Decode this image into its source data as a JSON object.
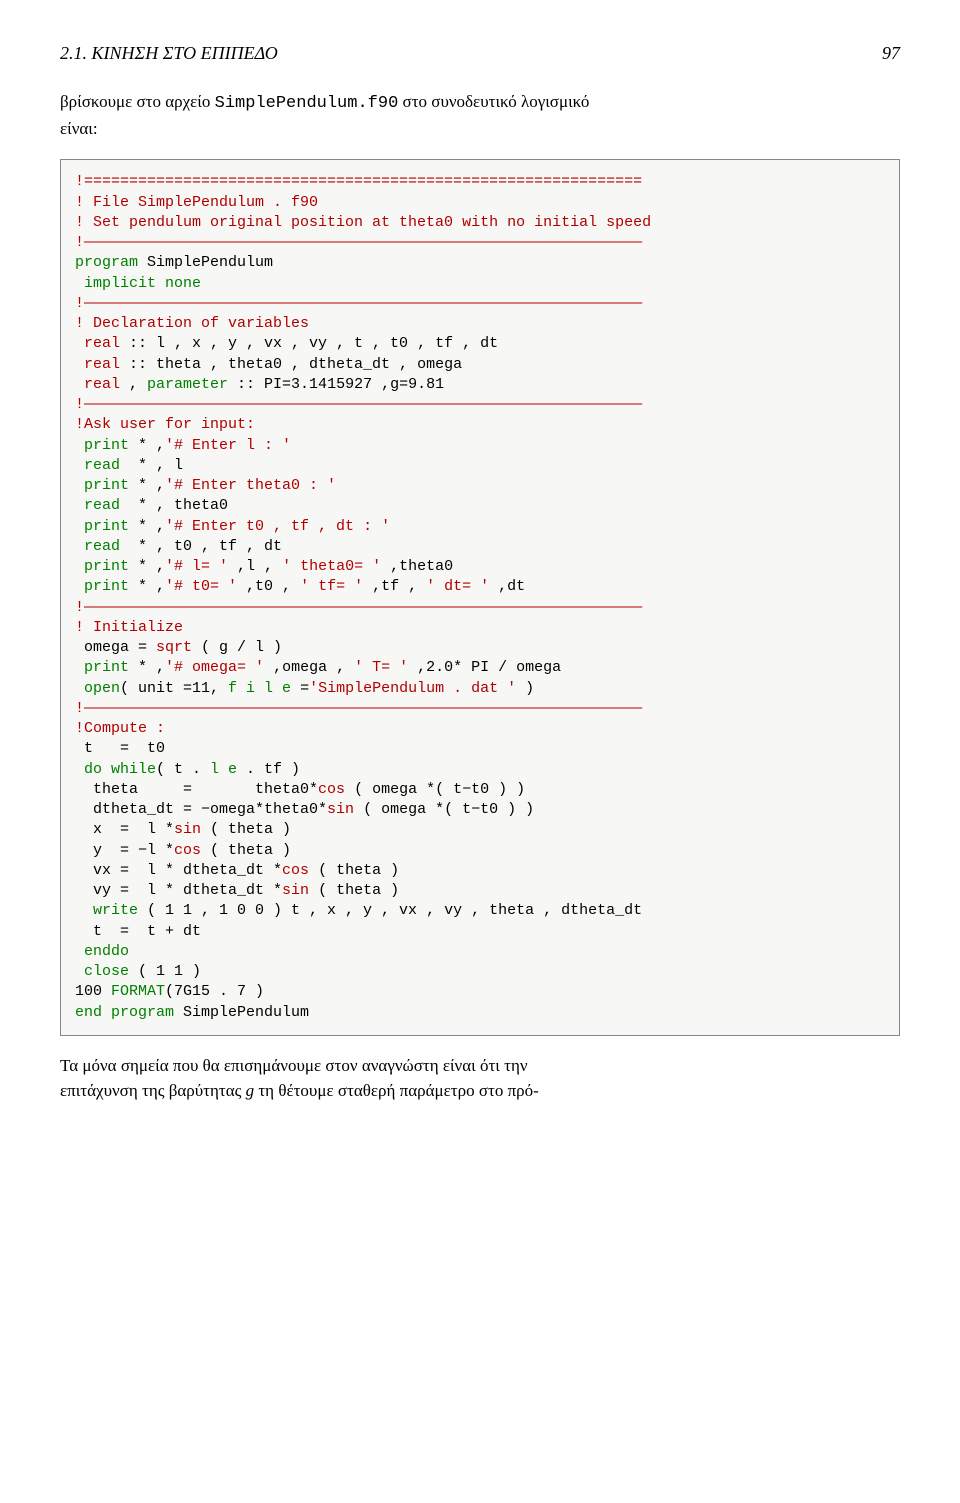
{
  "header": {
    "section": "2.1. ΚΙΝΗΣΗ ΣΤΟ ΕΠΙΠΕΔΟ",
    "page": "97"
  },
  "intro": {
    "line1_a": "βρίσκουμε στο αρχείο ",
    "line1_code": "SimplePendulum.f90",
    "line1_b": " στο συνοδευτικό λογισμικό",
    "line2": "είναι:"
  },
  "code": {
    "c1": "!==============================================================",
    "c2": "! File SimplePendulum . f90",
    "c3": "! Set pendulum original position at theta0 with no initial speed",
    "c4": "!——————————————————————————————————————————————————————————————",
    "kw_program": "program",
    "prog_name": " SimplePendulum",
    "kw_implicit": " implicit none",
    "c5": "!——————————————————————————————————————————————————————————————",
    "c6": "! Declaration of variables",
    "ty_real1": " real",
    "decl1": " :: l , x , y , vx , vy , t , t0 , tf , dt",
    "ty_real2": " real",
    "decl2": " :: theta , theta0 , dtheta_dt , omega",
    "ty_real3": " real",
    "param_kw": "parameter",
    "decl3a": " , ",
    "decl3b": " :: PI=3.1415927 ,g=9.81",
    "c7": "!——————————————————————————————————————————————————————————————",
    "c8": "!Ask user for input:",
    "kw_print": " print",
    "kw_read": " read",
    "s_enter_l": "'# Enter l : '",
    "rd_l": "  * , l",
    "s_enter_th0": "'# Enter theta0 : '",
    "rd_th0": "  * , theta0",
    "s_enter_t": "'# Enter t0 , tf , dt : '",
    "rd_t": "  * , t0 , tf , dt",
    "s_l_eq": "'# l= '",
    "s_th0_eq": "' theta0= '",
    "mid_l": " * ,",
    "mid_l2": " ,l , ",
    "mid_th0": " ,theta0",
    "s_t0_eq": "'# t0= '",
    "s_tf_eq": "' tf= '",
    "s_dt_eq": "' dt= '",
    "mid_t0": " ,t0 , ",
    "mid_tf": " ,tf , ",
    "mid_dt": " ,dt",
    "c9": "!——————————————————————————————————————————————————————————————",
    "c10": "! Initialize",
    "omega_line_a": " omega = ",
    "fn_sqrt": "sqrt",
    "omega_line_b": " ( g / l )",
    "s_omega": "'# omega= '",
    "s_T": "' T= '",
    "pr_omega_mid": " ,omega , ",
    "pr_T_end": " ,2.0* PI / omega",
    "kw_open": " open",
    "open_a": "( unit =11, ",
    "file_kw": "f i l e",
    "open_b": " =",
    "s_file": "'SimplePendulum . dat '",
    "open_c": " )",
    "c11": "!——————————————————————————————————————————————————————————————",
    "c12": "!Compute :",
    "t_eq_t0": " t   =  t0",
    "kw_do": " do while",
    "dow_a": "( t . ",
    "le_kw": "l e",
    "dow_b": " . tf )",
    "th_line_a": "  theta     =       theta0*",
    "fn_cos": "cos",
    "th_line_b": " ( omega *( t−t0 ) )",
    "dth_line_a": "  dtheta_dt = −omega*theta0*",
    "fn_sin": "sin",
    "dth_line_b": " ( omega *( t−t0 ) )",
    "x_line_a": "  x  =  l *",
    "x_line_b": " ( theta )",
    "y_line_a": "  y  = −l *",
    "y_line_b": " ( theta )",
    "vx_line_a": "  vx =  l * dtheta_dt *",
    "vx_line_b": " ( theta )",
    "vy_line_a": "  vy =  l * dtheta_dt *",
    "vy_line_b": " ( theta )",
    "kw_write": "  write",
    "write_rest": " ( 1 1 , 1 0 0 ) t , x , y , vx , vy , theta , dtheta_dt",
    "t_inc": "  t  =  t + dt",
    "kw_enddo": " enddo",
    "kw_close": " close",
    "close_rest": " ( 1 1 )",
    "fmt_100": "100 ",
    "fmt_kw": "FORMAT",
    "fmt_rest": "(7G15 . 7 )",
    "kw_end": "end program",
    "end_name": " SimplePendulum"
  },
  "outro": {
    "text_a": "Τα μόνα σημεία που θα επισημάνουμε στον αναγνώστη είναι ότι την",
    "text_b": "επιτάχυνση της βαρύτητας ",
    "g": "g",
    "text_c": " τη θέτουμε σταθερή παράμετρο στο πρό-"
  }
}
